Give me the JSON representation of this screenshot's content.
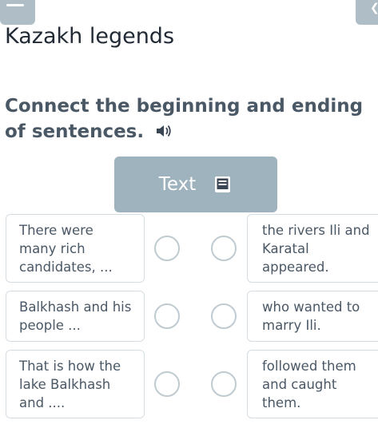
{
  "header": {
    "menu_icon": "hamburger-icon",
    "next_icon": "chevron-right-icon",
    "title": "Kazakh legends"
  },
  "task": {
    "instruction": "Connect the beginning and ending of sentences.",
    "speaker_icon": "speaker-icon",
    "text_button_label": "Text",
    "text_button_icon": "book-icon"
  },
  "beginnings": [
    "There were many rich candidates, ...",
    "Balkhash and his people ...",
    "That is how the lake Balkhash and ...."
  ],
  "endings": [
    "the rivers Ili and Karatal appeared.",
    "who wanted to marry Ili.",
    "followed them and caught them."
  ],
  "colors": {
    "accent": "#9fb3be",
    "border": "#d6dde2",
    "text": "#4a5866"
  }
}
